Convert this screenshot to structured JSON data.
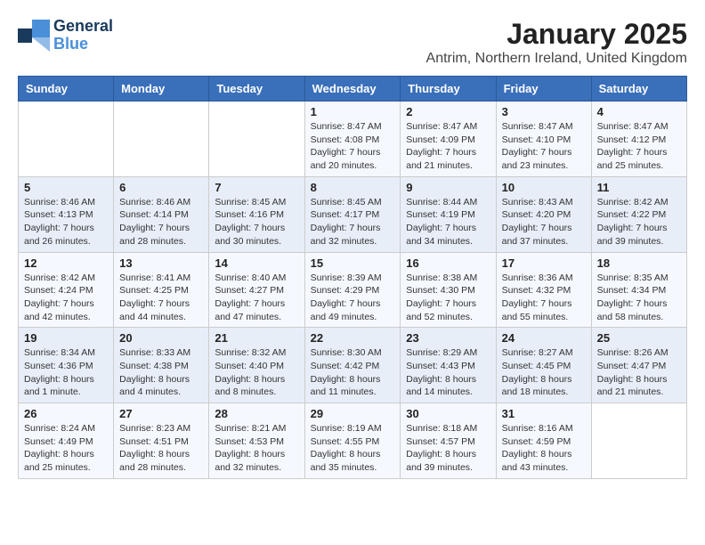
{
  "logo": {
    "line1": "General",
    "line2": "Blue"
  },
  "title": "January 2025",
  "location": "Antrim, Northern Ireland, United Kingdom",
  "headers": [
    "Sunday",
    "Monday",
    "Tuesday",
    "Wednesday",
    "Thursday",
    "Friday",
    "Saturday"
  ],
  "weeks": [
    [
      {
        "day": "",
        "info": ""
      },
      {
        "day": "",
        "info": ""
      },
      {
        "day": "",
        "info": ""
      },
      {
        "day": "1",
        "info": "Sunrise: 8:47 AM\nSunset: 4:08 PM\nDaylight: 7 hours\nand 20 minutes."
      },
      {
        "day": "2",
        "info": "Sunrise: 8:47 AM\nSunset: 4:09 PM\nDaylight: 7 hours\nand 21 minutes."
      },
      {
        "day": "3",
        "info": "Sunrise: 8:47 AM\nSunset: 4:10 PM\nDaylight: 7 hours\nand 23 minutes."
      },
      {
        "day": "4",
        "info": "Sunrise: 8:47 AM\nSunset: 4:12 PM\nDaylight: 7 hours\nand 25 minutes."
      }
    ],
    [
      {
        "day": "5",
        "info": "Sunrise: 8:46 AM\nSunset: 4:13 PM\nDaylight: 7 hours\nand 26 minutes."
      },
      {
        "day": "6",
        "info": "Sunrise: 8:46 AM\nSunset: 4:14 PM\nDaylight: 7 hours\nand 28 minutes."
      },
      {
        "day": "7",
        "info": "Sunrise: 8:45 AM\nSunset: 4:16 PM\nDaylight: 7 hours\nand 30 minutes."
      },
      {
        "day": "8",
        "info": "Sunrise: 8:45 AM\nSunset: 4:17 PM\nDaylight: 7 hours\nand 32 minutes."
      },
      {
        "day": "9",
        "info": "Sunrise: 8:44 AM\nSunset: 4:19 PM\nDaylight: 7 hours\nand 34 minutes."
      },
      {
        "day": "10",
        "info": "Sunrise: 8:43 AM\nSunset: 4:20 PM\nDaylight: 7 hours\nand 37 minutes."
      },
      {
        "day": "11",
        "info": "Sunrise: 8:42 AM\nSunset: 4:22 PM\nDaylight: 7 hours\nand 39 minutes."
      }
    ],
    [
      {
        "day": "12",
        "info": "Sunrise: 8:42 AM\nSunset: 4:24 PM\nDaylight: 7 hours\nand 42 minutes."
      },
      {
        "day": "13",
        "info": "Sunrise: 8:41 AM\nSunset: 4:25 PM\nDaylight: 7 hours\nand 44 minutes."
      },
      {
        "day": "14",
        "info": "Sunrise: 8:40 AM\nSunset: 4:27 PM\nDaylight: 7 hours\nand 47 minutes."
      },
      {
        "day": "15",
        "info": "Sunrise: 8:39 AM\nSunset: 4:29 PM\nDaylight: 7 hours\nand 49 minutes."
      },
      {
        "day": "16",
        "info": "Sunrise: 8:38 AM\nSunset: 4:30 PM\nDaylight: 7 hours\nand 52 minutes."
      },
      {
        "day": "17",
        "info": "Sunrise: 8:36 AM\nSunset: 4:32 PM\nDaylight: 7 hours\nand 55 minutes."
      },
      {
        "day": "18",
        "info": "Sunrise: 8:35 AM\nSunset: 4:34 PM\nDaylight: 7 hours\nand 58 minutes."
      }
    ],
    [
      {
        "day": "19",
        "info": "Sunrise: 8:34 AM\nSunset: 4:36 PM\nDaylight: 8 hours\nand 1 minute."
      },
      {
        "day": "20",
        "info": "Sunrise: 8:33 AM\nSunset: 4:38 PM\nDaylight: 8 hours\nand 4 minutes."
      },
      {
        "day": "21",
        "info": "Sunrise: 8:32 AM\nSunset: 4:40 PM\nDaylight: 8 hours\nand 8 minutes."
      },
      {
        "day": "22",
        "info": "Sunrise: 8:30 AM\nSunset: 4:42 PM\nDaylight: 8 hours\nand 11 minutes."
      },
      {
        "day": "23",
        "info": "Sunrise: 8:29 AM\nSunset: 4:43 PM\nDaylight: 8 hours\nand 14 minutes."
      },
      {
        "day": "24",
        "info": "Sunrise: 8:27 AM\nSunset: 4:45 PM\nDaylight: 8 hours\nand 18 minutes."
      },
      {
        "day": "25",
        "info": "Sunrise: 8:26 AM\nSunset: 4:47 PM\nDaylight: 8 hours\nand 21 minutes."
      }
    ],
    [
      {
        "day": "26",
        "info": "Sunrise: 8:24 AM\nSunset: 4:49 PM\nDaylight: 8 hours\nand 25 minutes."
      },
      {
        "day": "27",
        "info": "Sunrise: 8:23 AM\nSunset: 4:51 PM\nDaylight: 8 hours\nand 28 minutes."
      },
      {
        "day": "28",
        "info": "Sunrise: 8:21 AM\nSunset: 4:53 PM\nDaylight: 8 hours\nand 32 minutes."
      },
      {
        "day": "29",
        "info": "Sunrise: 8:19 AM\nSunset: 4:55 PM\nDaylight: 8 hours\nand 35 minutes."
      },
      {
        "day": "30",
        "info": "Sunrise: 8:18 AM\nSunset: 4:57 PM\nDaylight: 8 hours\nand 39 minutes."
      },
      {
        "day": "31",
        "info": "Sunrise: 8:16 AM\nSunset: 4:59 PM\nDaylight: 8 hours\nand 43 minutes."
      },
      {
        "day": "",
        "info": ""
      }
    ]
  ]
}
